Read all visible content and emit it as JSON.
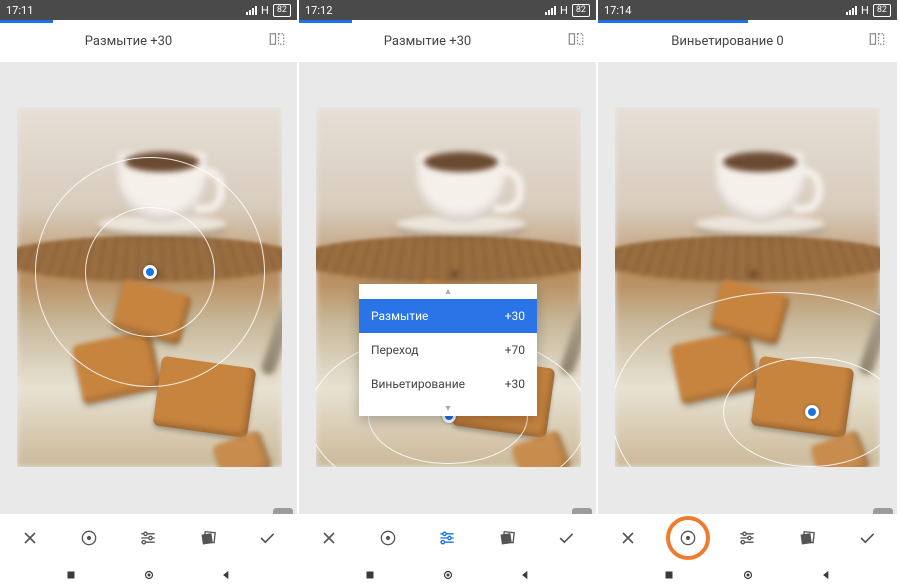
{
  "screens": [
    {
      "time": "17:11",
      "signal_label": "H",
      "battery": "82",
      "tool_title": "Размытие +30",
      "progress_pct": 18
    },
    {
      "time": "17:12",
      "signal_label": "H",
      "battery": "82",
      "tool_title": "Размытие +30",
      "progress_pct": 18,
      "options": [
        {
          "label": "Размытие",
          "value": "+30",
          "selected": true
        },
        {
          "label": "Переход",
          "value": "+70",
          "selected": false
        },
        {
          "label": "Виньетирование",
          "value": "+30",
          "selected": false
        }
      ]
    },
    {
      "time": "17:14",
      "signal_label": "H",
      "battery": "82",
      "tool_title": "Виньетирование 0",
      "progress_pct": 50
    }
  ],
  "buttons": {
    "cancel": "✕",
    "shape": "◉",
    "sliders": "≡",
    "style": "◩",
    "apply": "✓"
  }
}
